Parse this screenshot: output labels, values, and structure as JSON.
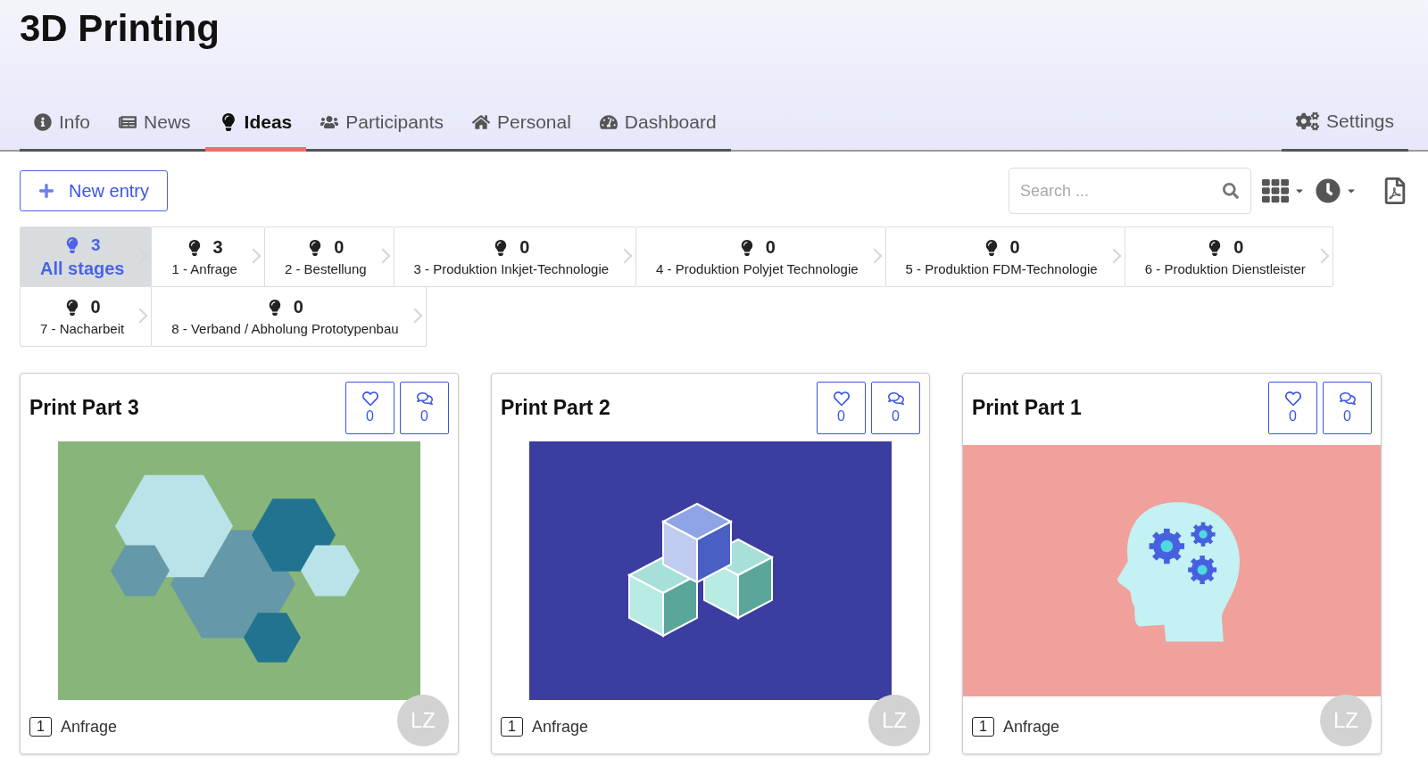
{
  "title": "3D Printing",
  "tabs": [
    {
      "label": "Info",
      "selected": false
    },
    {
      "label": "News",
      "selected": false
    },
    {
      "label": "Ideas",
      "selected": true
    },
    {
      "label": "Participants",
      "selected": false
    },
    {
      "label": "Personal",
      "selected": false
    },
    {
      "label": "Dashboard",
      "selected": false
    }
  ],
  "settings_tab": {
    "label": "Settings",
    "selected": false
  },
  "new_entry_button": "New entry",
  "search": {
    "placeholder": "Search ..."
  },
  "stages": [
    {
      "count": "3",
      "label": "All stages",
      "selected": true
    },
    {
      "count": "3",
      "label": "1 - Anfrage",
      "selected": false
    },
    {
      "count": "0",
      "label": "2 - Bestellung",
      "selected": false
    },
    {
      "count": "0",
      "label": "3 - Produktion Inkjet-Technologie",
      "selected": false
    },
    {
      "count": "0",
      "label": "4 - Produktion Polyjet Technologie",
      "selected": false
    },
    {
      "count": "0",
      "label": "5 - Produktion FDM-Technologie",
      "selected": false
    },
    {
      "count": "0",
      "label": "6 - Produktion Dienstleister",
      "selected": false
    },
    {
      "count": "0",
      "label": "7 - Nacharbeit",
      "selected": false
    },
    {
      "count": "0",
      "label": "8 - Verband / Abholung Prototypenbau",
      "selected": false
    }
  ],
  "cards": [
    {
      "title": "Print Part 3",
      "likes": "0",
      "comments": "0",
      "image": {
        "kind": "hexagons"
      },
      "stage_number": "1",
      "stage": "Anfrage",
      "avatar": "LZ"
    },
    {
      "title": "Print Part 2",
      "likes": "0",
      "comments": "0",
      "image": {
        "kind": "cubes"
      },
      "stage_number": "1",
      "stage": "Anfrage",
      "avatar": "LZ"
    },
    {
      "title": "Print Part 1",
      "likes": "0",
      "comments": "0",
      "image": {
        "kind": "head"
      },
      "stage_number": "1",
      "stage": "Anfrage",
      "avatar": "LZ"
    }
  ]
}
